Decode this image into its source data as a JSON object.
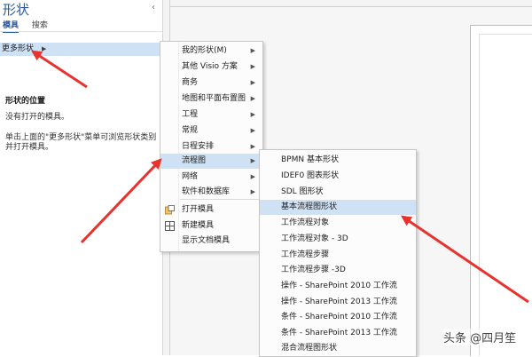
{
  "pane": {
    "title": "形状",
    "collapse_glyph": "‹",
    "tabs": [
      {
        "label": "模具"
      },
      {
        "label": "搜索"
      }
    ],
    "more_shapes": "更多形状",
    "info_title": "形状的位置",
    "no_stencil": "没有打开的模具。",
    "hint_line1": "单击上面的\"更多形状\"菜单可浏览形状类别",
    "hint_line2": "并打开模具。"
  },
  "menu1": {
    "items": [
      {
        "label": "我的形状(M)",
        "submenu": true
      },
      {
        "label": "其他 Visio 方案",
        "submenu": true
      },
      {
        "label": "商务",
        "submenu": true
      },
      {
        "label": "地图和平面布置图",
        "submenu": true
      },
      {
        "label": "工程",
        "submenu": true
      },
      {
        "label": "常规",
        "submenu": true
      },
      {
        "label": "日程安排",
        "submenu": true
      },
      {
        "label": "流程图",
        "submenu": true
      },
      {
        "label": "网络",
        "submenu": true
      },
      {
        "label": "软件和数据库",
        "submenu": true
      },
      {
        "label": "打开模具",
        "icon": "open-stencil-icon"
      },
      {
        "label": "新建模具",
        "icon": "new-stencil-icon"
      },
      {
        "label": "显示文档模具"
      }
    ],
    "submenu_glyph": "▶",
    "highlighted": "流程图"
  },
  "menu2": {
    "items": [
      {
        "label": "BPMN 基本形状"
      },
      {
        "label": "IDEF0 图表形状"
      },
      {
        "label": "SDL 图形状"
      },
      {
        "label": "基本流程图形状"
      },
      {
        "label": "工作流程对象"
      },
      {
        "label": "工作流程对象 - 3D"
      },
      {
        "label": "工作流程步骤"
      },
      {
        "label": "工作流程步骤 -3D"
      },
      {
        "label": "操作 - SharePoint 2010 工作流"
      },
      {
        "label": "操作 - SharePoint 2013 工作流"
      },
      {
        "label": "条件 - SharePoint 2010 工作流"
      },
      {
        "label": "条件 - SharePoint 2013 工作流"
      },
      {
        "label": "混合流程图形状"
      }
    ],
    "highlighted": "基本流程图形状"
  },
  "watermark": "头条 @四月笙",
  "colors": {
    "accent": "#2a579a",
    "highlight": "#cfe1f4",
    "arrow": "#e8322d"
  }
}
